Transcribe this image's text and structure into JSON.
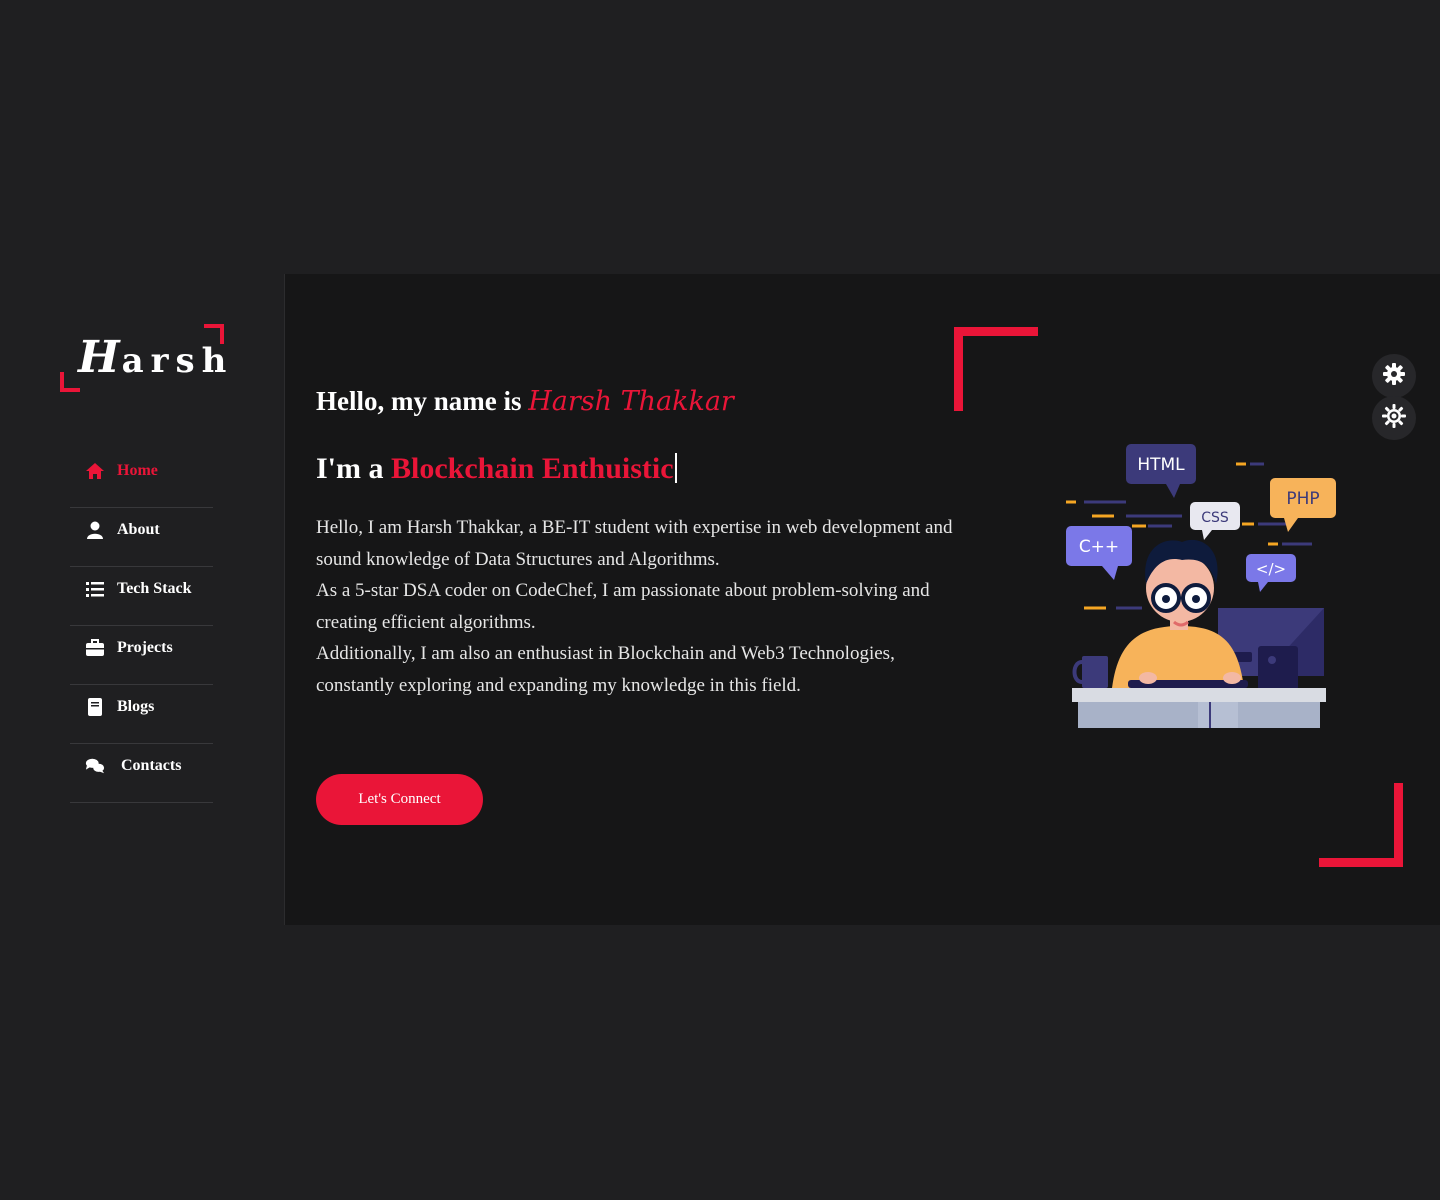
{
  "logo": {
    "first_letter": "H",
    "rest": "arsh"
  },
  "nav": [
    {
      "label": "Home",
      "icon": "home-icon",
      "active": true
    },
    {
      "label": "About",
      "icon": "user-icon",
      "active": false
    },
    {
      "label": "Tech Stack",
      "icon": "list-icon",
      "active": false
    },
    {
      "label": "Projects",
      "icon": "briefcase-icon",
      "active": false
    },
    {
      "label": "Blogs",
      "icon": "book-icon",
      "active": false
    },
    {
      "label": "Contacts",
      "icon": "chat-icon",
      "active": false
    }
  ],
  "hero": {
    "greeting": "Hello, my name is",
    "name": "Harsh Thakkar",
    "role_prefix": "I'm a",
    "role": "Blockchain Enthuistic",
    "bio": [
      "Hello, I am Harsh Thakkar, a BE-IT student with expertise in web development and sound knowledge of Data Structures and Algorithms.",
      "As a 5-star DSA coder on CodeChef, I am passionate about problem-solving and creating efficient algorithms.",
      "Additionally, I am also an enthusiast in Blockchain and Web3 Technologies, constantly exploring and expanding my knowledge in this field."
    ],
    "cta": "Let's Connect"
  },
  "illustration": {
    "bubbles": [
      "HTML",
      "CSS",
      "PHP",
      "C++",
      "</>"
    ]
  },
  "colors": {
    "accent": "#ea1538",
    "background": "#161617",
    "sidebar": "#1f1f21"
  }
}
